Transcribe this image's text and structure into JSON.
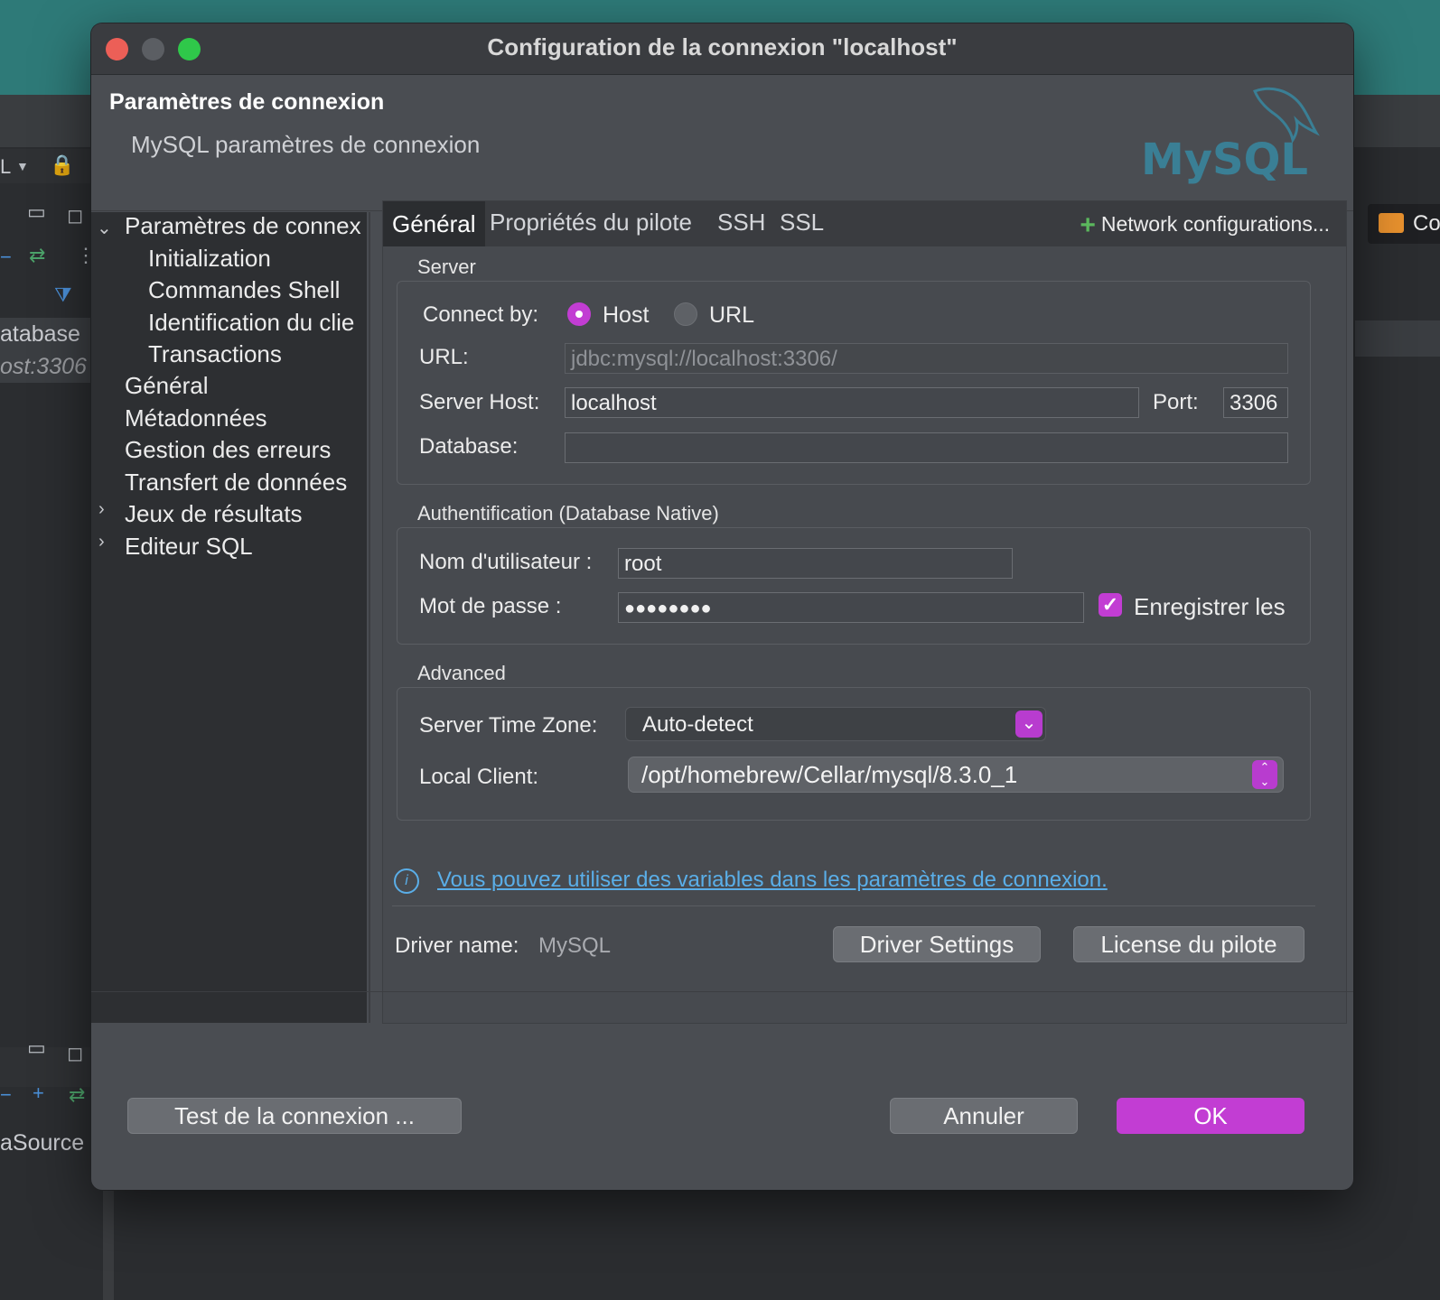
{
  "background": {
    "left_labels": [
      "atabase",
      "ost:3306",
      "aSource"
    ],
    "right_tab_label": "Co",
    "left_top_letter": "L"
  },
  "dialog": {
    "title": "Configuration de la connexion \"localhost\"",
    "header_title": "Paramètres de connexion",
    "header_subtitle": "MySQL paramètres de connexion",
    "logo_text": "MySQL"
  },
  "sidebar": {
    "items": [
      {
        "label": "Paramètres de connex",
        "expanded": true
      },
      {
        "label": "Initialization"
      },
      {
        "label": "Commandes Shell"
      },
      {
        "label": "Identification du clie"
      },
      {
        "label": "Transactions"
      },
      {
        "label": "Général"
      },
      {
        "label": "Métadonnées"
      },
      {
        "label": "Gestion des erreurs"
      },
      {
        "label": "Transfert de données"
      },
      {
        "label": "Jeux de résultats",
        "collapsed": true
      },
      {
        "label": "Editeur SQL",
        "collapsed": true
      }
    ]
  },
  "tabs": [
    "Général",
    "Propriétés du pilote",
    "SSH",
    "SSL"
  ],
  "network_config_label": "Network configurations...",
  "server": {
    "group_label": "Server",
    "connect_by_label": "Connect by:",
    "option_host": "Host",
    "option_url": "URL",
    "url_label": "URL:",
    "url_value": "jdbc:mysql://localhost:3306/",
    "host_label": "Server Host:",
    "host_value": "localhost",
    "port_label": "Port:",
    "port_value": "3306",
    "database_label": "Database:",
    "database_value": ""
  },
  "auth": {
    "group_label": "Authentification (Database Native)",
    "user_label": "Nom d'utilisateur :",
    "user_value": "root",
    "password_label": "Mot de passe :",
    "password_value": "●●●●●●●●",
    "save_label": "Enregistrer les"
  },
  "advanced": {
    "group_label": "Advanced",
    "timezone_label": "Server Time Zone:",
    "timezone_value": "Auto-detect",
    "client_label": "Local Client:",
    "client_value": "/opt/homebrew/Cellar/mysql/8.3.0_1"
  },
  "info_link": "Vous pouvez utiliser des variables dans les paramètres de connexion.",
  "driver": {
    "label": "Driver name:",
    "value": "MySQL",
    "settings_button": "Driver Settings",
    "license_button": "License du pilote"
  },
  "buttons": {
    "test": "Test de la connexion ...",
    "cancel": "Annuler",
    "ok": "OK"
  },
  "colors": {
    "accent": "#c23dd3",
    "link": "#5aaee8",
    "titlebar_teal": "#2e7a78"
  }
}
